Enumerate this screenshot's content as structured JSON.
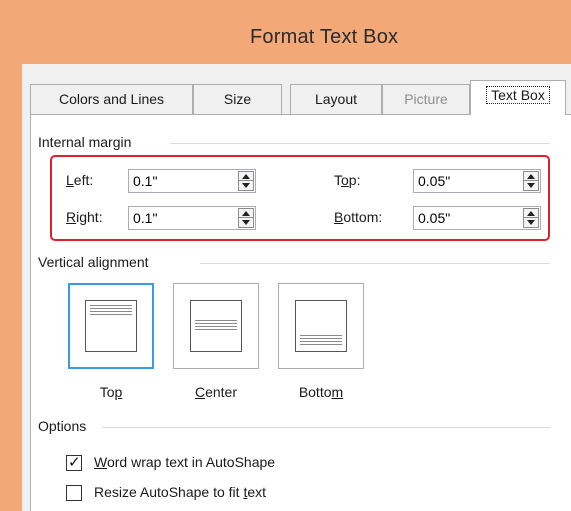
{
  "window": {
    "title": "Format Text Box",
    "accent_color": "#f3a878",
    "highlight_color": "#e0202c"
  },
  "tabs": [
    {
      "label": "Colors and Lines",
      "state": "normal"
    },
    {
      "label": "Size",
      "state": "normal"
    },
    {
      "label": "Layout",
      "state": "normal"
    },
    {
      "label": "Picture",
      "state": "disabled"
    },
    {
      "label": "Text Box",
      "state": "active"
    }
  ],
  "internal_margin": {
    "heading": "Internal margin",
    "left": {
      "label_u": "L",
      "label_rest": "eft:",
      "value": "0.1\""
    },
    "right": {
      "label_u": "R",
      "label_rest": "ight:",
      "value": "0.1\""
    },
    "top": {
      "label_pre": "T",
      "label_u": "o",
      "label_rest": "p:",
      "value": "0.05\""
    },
    "bottom": {
      "label_u": "B",
      "label_rest": "ottom:",
      "value": "0.05\""
    }
  },
  "vertical_alignment": {
    "heading": "Vertical alignment",
    "selected": "Top",
    "options": [
      {
        "pre": "To",
        "u": "p",
        "post": ""
      },
      {
        "pre": "",
        "u": "C",
        "post": "enter"
      },
      {
        "pre": "Botto",
        "u": "m",
        "post": ""
      }
    ]
  },
  "options": {
    "heading": "Options",
    "word_wrap": {
      "checked": true,
      "pre": "",
      "u": "W",
      "post": "ord wrap text in AutoShape"
    },
    "resize": {
      "checked": false,
      "pre": "Resize AutoShape to fit ",
      "u": "t",
      "post": "ext"
    }
  }
}
